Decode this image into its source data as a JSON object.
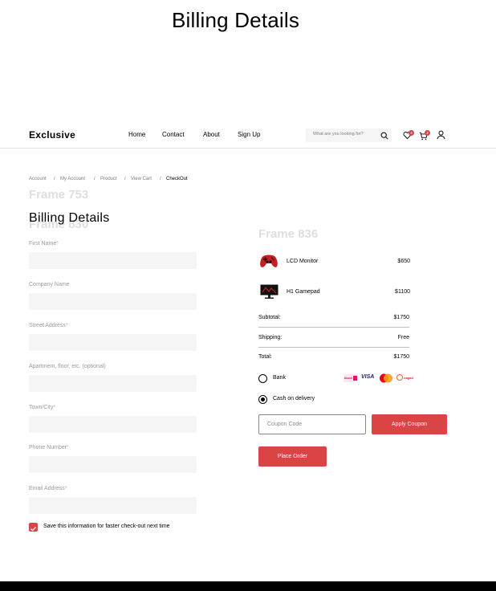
{
  "page_title": "Billing Details",
  "header": {
    "logo": "Exclusive",
    "nav": [
      "Home",
      "Contact",
      "About",
      "Sign Up"
    ],
    "search_placeholder": "What are you looking for?",
    "wishlist_count": "4",
    "cart_count": "2",
    "icons": [
      "search-icon",
      "heart-icon",
      "cart-icon",
      "user-icon"
    ]
  },
  "breadcrumb": {
    "items": [
      "Account",
      "My Account",
      "Product",
      "View Cart",
      "CheckOut"
    ],
    "separator": "/"
  },
  "ghost_labels": {
    "frame_753": "Frame 753",
    "frame_830": "Frame 830",
    "frame_836": "Frame 836"
  },
  "form": {
    "title": "Billing Details",
    "required_mark": "*",
    "fields": [
      {
        "label": "First Name",
        "required": true,
        "value": ""
      },
      {
        "label": "Company Name",
        "required": false,
        "value": ""
      },
      {
        "label": "Street Address",
        "required": true,
        "value": ""
      },
      {
        "label": "Apartment, floor, etc. (optional)",
        "required": false,
        "value": ""
      },
      {
        "label": "Town/City",
        "required": true,
        "value": ""
      },
      {
        "label": "Phone Number",
        "required": true,
        "value": ""
      },
      {
        "label": "Email Address",
        "required": true,
        "value": ""
      }
    ],
    "save_info": {
      "label": "Save this information for faster check-out next time",
      "checked": true
    }
  },
  "order": {
    "items": [
      {
        "name": "LCD Monitor",
        "price": "$650",
        "image": "gamepad-image"
      },
      {
        "name": "H1 Gamepad",
        "price": "$1100",
        "image": "monitor-image"
      }
    ],
    "subtotal_label": "Subtotal:",
    "subtotal": "$1750",
    "shipping_label": "Shipping:",
    "shipping": "Free",
    "total_label": "Total:",
    "total": "$1750",
    "payment": {
      "options": [
        {
          "label": "Bank",
          "selected": false
        },
        {
          "label": "Cash on delivery",
          "selected": true
        }
      ],
      "card_logos": [
        "bkash",
        "VISA",
        "mastercard",
        "nagad"
      ]
    },
    "coupon_placeholder": "Coupon Code",
    "apply_coupon": "Apply Coupon",
    "place_order": "Place Order"
  },
  "colors": {
    "accent": "#DB4444",
    "field_bg": "#F5F5F5",
    "muted": "#7D7D7D",
    "footer": "#000000"
  }
}
